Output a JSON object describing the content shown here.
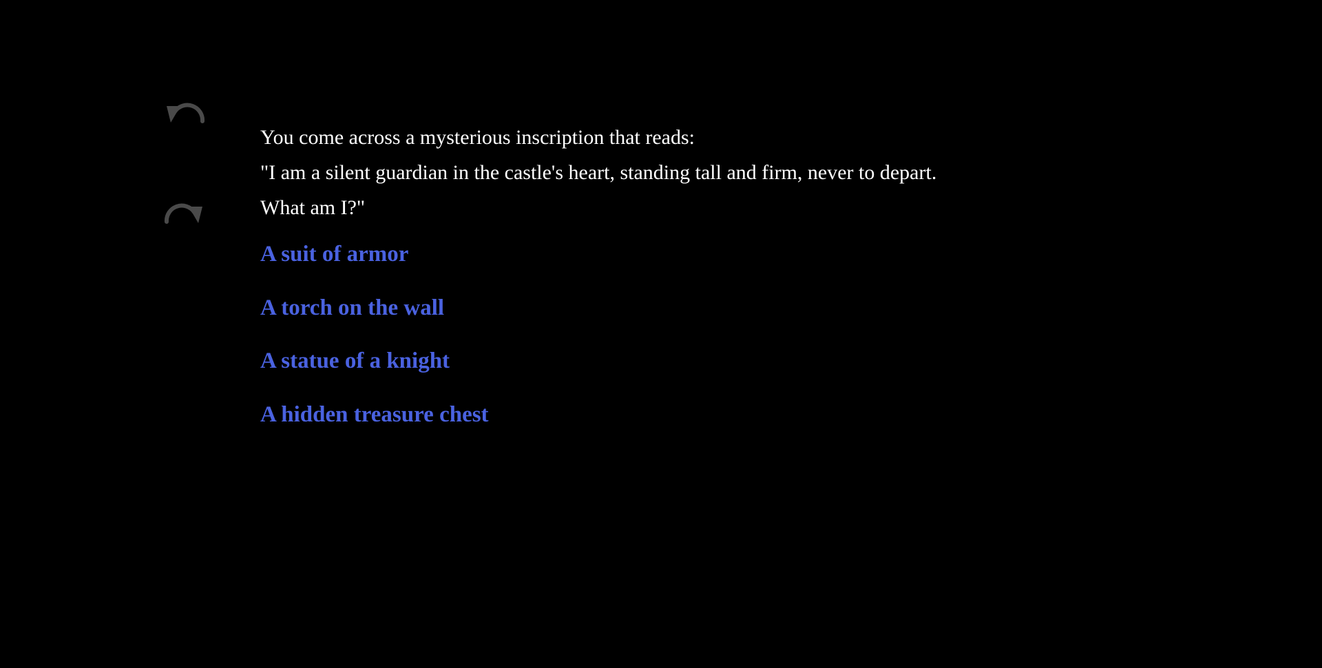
{
  "sidebar": {
    "undo_icon": "undo-arrow-icon",
    "redo_icon": "redo-arrow-icon",
    "icon_color": "#4a4a4a"
  },
  "passage": {
    "lines": [
      "You come across a mysterious inscription that reads:",
      "\"I am a silent guardian in the castle's heart, standing tall and firm, never to depart.",
      "What am I?\""
    ]
  },
  "choices": [
    {
      "label": "A suit of armor"
    },
    {
      "label": "A torch on the wall"
    },
    {
      "label": "A statue of a knight"
    },
    {
      "label": "A hidden treasure chest"
    }
  ],
  "colors": {
    "background": "#000000",
    "text": "#ffffff",
    "link": "#4a62e0"
  }
}
